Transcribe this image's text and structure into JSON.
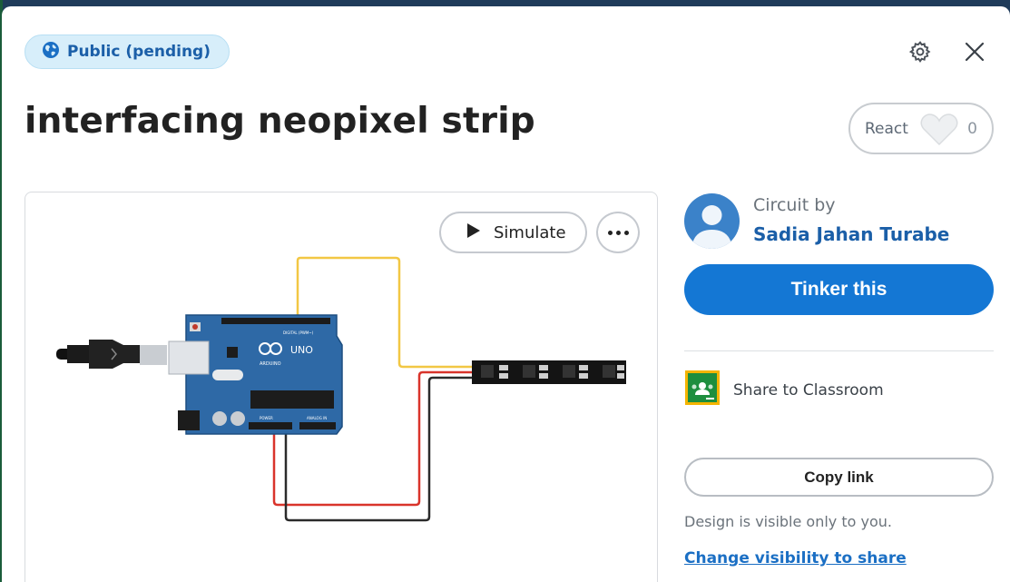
{
  "visibility": {
    "badge_label": "Public (pending)",
    "icon": "globe-icon"
  },
  "header": {
    "settings_icon": "gear-icon",
    "close_icon": "close-icon"
  },
  "project": {
    "title": "interfacing neopixel strip"
  },
  "react": {
    "label": "React",
    "count": "0",
    "icon": "heart-icon"
  },
  "canvas": {
    "simulate_label": "Simulate",
    "more_icon": "more-options-icon",
    "board_text": "UNO",
    "board_brand": "ARDUINO",
    "digital_label": "DIGITAL (PWM~)",
    "power_label": "POWER",
    "analog_label": "ANALOG IN",
    "wire_colors": {
      "signal": "#f2c744",
      "power": "#d9342b",
      "ground": "#2b2b2b"
    }
  },
  "author": {
    "by_label": "Circuit by",
    "name": "Sadia Jahan Turabe"
  },
  "actions": {
    "tinker_label": "Tinker this",
    "classroom_label": "Share to Classroom",
    "copy_link_label": "Copy link",
    "visible_note": "Design is visible only to you.",
    "change_visibility_label": "Change visibility to share"
  },
  "colors": {
    "accent": "#1477d4",
    "link": "#1b5fa8",
    "badge_bg": "#d7eefa"
  }
}
